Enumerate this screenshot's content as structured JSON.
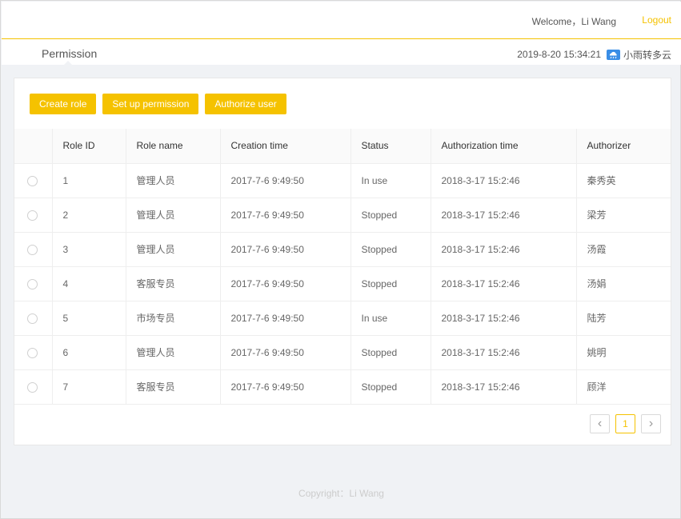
{
  "header": {
    "welcome": "Welcome，Li Wang",
    "logout": "Logout"
  },
  "subbar": {
    "page_title": "Permission",
    "datetime": "2019-8-20 15:34:21",
    "weather": "小雨转多云",
    "weather_icon": "cloud-rain-icon"
  },
  "toolbar": {
    "create_role": "Create role",
    "set_permission": "Set up permission",
    "authorize_user": "Authorize user"
  },
  "table": {
    "columns": [
      "",
      "Role ID",
      "Role name",
      "Creation time",
      "Status",
      "Authorization time",
      "Authorizer"
    ],
    "rows": [
      {
        "id": "1",
        "name": "管理人员",
        "created": "2017-7-6 9:49:50",
        "status": "In use",
        "auth_time": "2018-3-17 15:2:46",
        "authorizer": "秦秀英"
      },
      {
        "id": "2",
        "name": "管理人员",
        "created": "2017-7-6 9:49:50",
        "status": "Stopped",
        "auth_time": "2018-3-17 15:2:46",
        "authorizer": "梁芳"
      },
      {
        "id": "3",
        "name": "管理人员",
        "created": "2017-7-6 9:49:50",
        "status": "Stopped",
        "auth_time": "2018-3-17 15:2:46",
        "authorizer": "汤霞"
      },
      {
        "id": "4",
        "name": "客服专员",
        "created": "2017-7-6 9:49:50",
        "status": "Stopped",
        "auth_time": "2018-3-17 15:2:46",
        "authorizer": "汤娟"
      },
      {
        "id": "5",
        "name": "市场专员",
        "created": "2017-7-6 9:49:50",
        "status": "In use",
        "auth_time": "2018-3-17 15:2:46",
        "authorizer": "陆芳"
      },
      {
        "id": "6",
        "name": "管理人员",
        "created": "2017-7-6 9:49:50",
        "status": "Stopped",
        "auth_time": "2018-3-17 15:2:46",
        "authorizer": "姚明"
      },
      {
        "id": "7",
        "name": "客服专员",
        "created": "2017-7-6 9:49:50",
        "status": "Stopped",
        "auth_time": "2018-3-17 15:2:46",
        "authorizer": "顾洋"
      }
    ]
  },
  "pagination": {
    "prev": "‹",
    "current": "1",
    "next": "›"
  },
  "footer": {
    "copyright": "Copyright：Li Wang"
  },
  "colors": {
    "accent": "#f5c200",
    "background": "#f0f2f5"
  }
}
